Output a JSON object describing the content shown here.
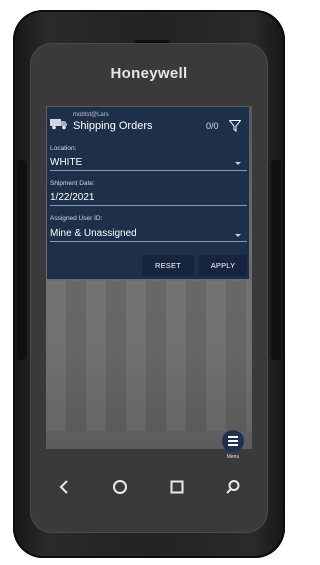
{
  "device": {
    "brand": "Honeywell"
  },
  "header": {
    "subtitle": "mobtst@Lars",
    "title": "Shipping Orders",
    "count": "0/0",
    "truck_icon": "truck-icon",
    "filter_icon": "funnel-icon"
  },
  "filters": {
    "location": {
      "label": "Location:",
      "value": "WHITE"
    },
    "shipment_date": {
      "label": "Shipment Date:",
      "value": "1/22/2021"
    },
    "assigned_user": {
      "label": "Assigned User ID:",
      "value": "Mine & Unassigned"
    }
  },
  "buttons": {
    "reset": "RESET",
    "apply": "APPLY"
  },
  "menu": {
    "label": "Menu",
    "icon": "hamburger-icon"
  },
  "nav": {
    "back_icon": "back-icon",
    "home_icon": "home-icon",
    "recents_icon": "recents-icon",
    "search_icon": "search-icon"
  },
  "colors": {
    "panel": "#1e2f4a",
    "button": "#16253d",
    "fab": "#1e3150"
  }
}
